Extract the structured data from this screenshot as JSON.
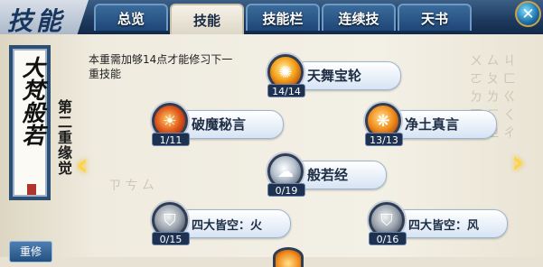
{
  "header": {
    "title": "技能",
    "tabs": [
      {
        "label": "总览",
        "active": false
      },
      {
        "label": "技能",
        "active": true
      },
      {
        "label": "技能栏",
        "active": false
      },
      {
        "label": "连续技",
        "active": false
      },
      {
        "label": "天书",
        "active": false
      }
    ],
    "close_icon": "close-icon"
  },
  "sidebar": {
    "scroll_text": "大梵般若",
    "stage": "第二重缘觉",
    "repair_button": "重修"
  },
  "main": {
    "description": "本重需加够14点才能修习下一重技能",
    "skills": [
      {
        "name": "天舞宝轮",
        "level": "14/14",
        "icon": "wheel-icon"
      },
      {
        "name": "破魔秘言",
        "level": "1/11",
        "icon": "sun-icon"
      },
      {
        "name": "净土真言",
        "level": "13/13",
        "icon": "flame-icon"
      },
      {
        "name": "般若经",
        "level": "0/19",
        "icon": "cloud-icon"
      },
      {
        "name": "四大皆空：火",
        "level": "0/15",
        "icon": "shield-icon"
      },
      {
        "name": "四大皆空：风",
        "level": "0/16",
        "icon": "shield-icon"
      }
    ]
  },
  "colors": {
    "header_blue": "#1d3a5e",
    "accent_gold": "#ffd24a",
    "panel_bg": "#f3f0e6"
  }
}
